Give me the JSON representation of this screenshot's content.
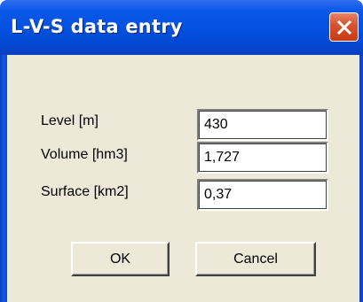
{
  "window": {
    "title": "L-V-S data entry"
  },
  "form": {
    "level": {
      "label": "Level [m]",
      "value": "430"
    },
    "volume": {
      "label": "Volume [hm3]",
      "value": "1,727"
    },
    "surface": {
      "label": "Surface [km2]",
      "value": "0,37"
    }
  },
  "buttons": {
    "ok": "OK",
    "cancel": "Cancel"
  },
  "icons": {
    "close": "close-icon"
  },
  "colors": {
    "titlebar": "#0450e0",
    "close_button": "#d9542f",
    "dialog_background": "#ece9d8"
  }
}
